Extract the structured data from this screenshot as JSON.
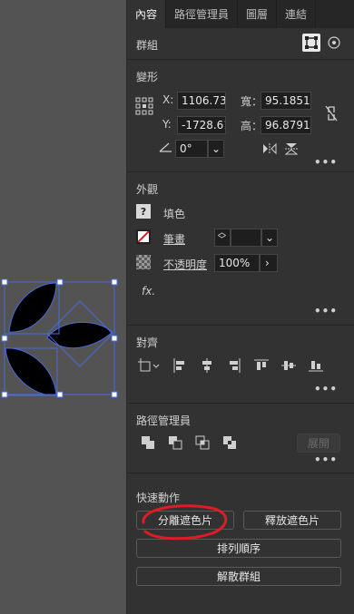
{
  "tabs": [
    "內容",
    "路徑管理員",
    "圖層",
    "連結"
  ],
  "group": {
    "label": "群組"
  },
  "transform": {
    "title": "變形",
    "x_label": "X:",
    "x_value": "1106.73",
    "y_label": "Y:",
    "y_value": "-1728.61",
    "w_label": "寬：",
    "w_value": "95.1851",
    "h_label": "高：",
    "h_value": "96.8791",
    "angle_value": "0°"
  },
  "appearance": {
    "title": "外觀",
    "fill_label": "填色",
    "stroke_label": "筆畫",
    "opacity_label": "不透明度",
    "opacity_value": "100%",
    "fx_label": "fx."
  },
  "align": {
    "title": "對齊"
  },
  "pathfinder": {
    "title": "路徑管理員",
    "expand_label": "展開"
  },
  "quick_actions": {
    "title": "快速動作",
    "release_clip": "分離遮色片",
    "release_mask": "釋放遮色片",
    "arrange": "排列順序",
    "ungroup": "解散群組"
  },
  "more_label": "•••",
  "colors": {
    "panel": "#323232",
    "selection": "#4a6bd8",
    "annotation": "#e01b24"
  }
}
